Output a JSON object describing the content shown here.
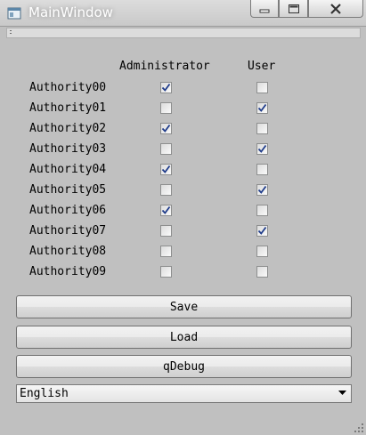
{
  "window": {
    "title": "MainWindow",
    "controls": {
      "minimize": "minimize",
      "maximize": "maximize",
      "close": "close"
    }
  },
  "table": {
    "headers": {
      "admin": "Administrator",
      "user": "User"
    },
    "rows": [
      {
        "label": "Authority00",
        "admin": true,
        "user": false
      },
      {
        "label": "Authority01",
        "admin": false,
        "user": true
      },
      {
        "label": "Authority02",
        "admin": true,
        "user": false
      },
      {
        "label": "Authority03",
        "admin": false,
        "user": true
      },
      {
        "label": "Authority04",
        "admin": true,
        "user": false
      },
      {
        "label": "Authority05",
        "admin": false,
        "user": true
      },
      {
        "label": "Authority06",
        "admin": true,
        "user": false
      },
      {
        "label": "Authority07",
        "admin": false,
        "user": true
      },
      {
        "label": "Authority08",
        "admin": false,
        "user": false
      },
      {
        "label": "Authority09",
        "admin": false,
        "user": false
      }
    ]
  },
  "buttons": {
    "save": "Save",
    "load": "Load",
    "debug": "qDebug"
  },
  "language": {
    "selected": "English"
  },
  "colors": {
    "window_bg": "#c0c0c0",
    "check_mark": "#1f3c8a"
  }
}
